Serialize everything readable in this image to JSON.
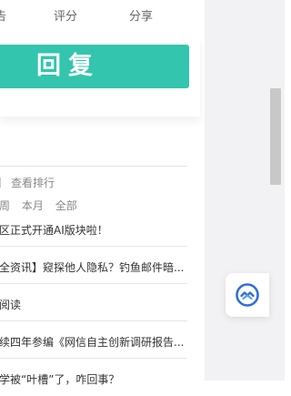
{
  "tabs": [
    "告",
    "评分",
    "分享"
  ],
  "reply_button": "回复",
  "ranking": {
    "title": "查看排行",
    "periods": [
      "周",
      "本月",
      "全部"
    ],
    "items": [
      "区正式开通AI版块啦！",
      "全资讯】窥探他人隐私？钓鱼邮件暗...",
      "阅读",
      "续四年参编《网信自主创新调研报告...",
      "学被“叶槽”了，咋回事？"
    ]
  },
  "float_button_icon": "assistant-logo-icon",
  "colors": {
    "accent": "#33c5ad",
    "icon_blue": "#2f6fd8"
  }
}
